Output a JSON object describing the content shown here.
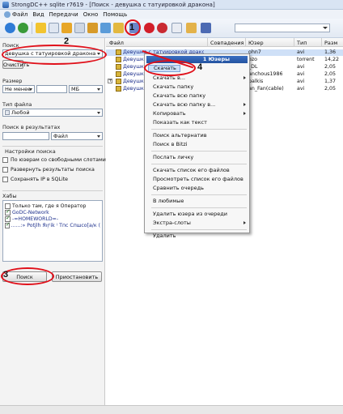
{
  "window": {
    "title": "StrongDC++ sqlite r7619 - [Поиск - девушка с татуировкой дракона]"
  },
  "menu": {
    "items": [
      "Файл",
      "Вид",
      "Передачи",
      "Окно",
      "Помощь"
    ]
  },
  "left": {
    "search_label": "Поиск",
    "search_value": "девушка с татуировкой дракона",
    "clear_button": "Очистить",
    "size_label": "Размер",
    "size_mode": "Не менее",
    "size_unit": "МБ",
    "filetype_label": "Тип файла",
    "filetype_value": "Любой",
    "inresults_label": "Поиск в результатах",
    "inresults_field": "Файл",
    "settings_label": "Настройки поиска",
    "opt1": "По юзерам со свободными слотами",
    "opt2": "Развернуть результаты поиска",
    "opt3": "Сохранять IP в SQLite",
    "hubs_label": "Хабы",
    "hubs": [
      {
        "label": "Только там, где я Оператор",
        "checked": false
      },
      {
        "label": "GoDC-Network",
        "checked": true
      },
      {
        "label": "-=HOMEWORLD=-",
        "checked": true
      },
      {
        "label": "......:» Potjlh Яıŗ⁽ik ⁾ Тпс Спшсо[а/к (",
        "checked": true
      }
    ],
    "search_button": "Поиск",
    "pause_button": "Приостановить"
  },
  "results": {
    "columns": [
      "Файл",
      "Совпадения",
      "Юзер",
      "Тип",
      "Разм"
    ],
    "rows": [
      {
        "file": "Девушка с татуировкой дракона",
        "user": "ohn7",
        "type": "avi",
        "size": "1,36"
      },
      {
        "file": "Девушк...",
        "user": "ozo",
        "type": "torrent",
        "size": "14,22"
      },
      {
        "file": "Девушк...",
        "user": "_DL",
        "type": "avi",
        "size": "2,05"
      },
      {
        "file": "Девушк...",
        "user": "anchous1986",
        "type": "avi",
        "size": "2,05"
      },
      {
        "file": "Девушк...",
        "user": "palkis",
        "type": "avi",
        "size": "1,37"
      },
      {
        "file": "Девушк...",
        "user": "an_Fan(cable)",
        "type": "avi",
        "size": "2,05"
      }
    ]
  },
  "context_menu": {
    "title": "1 Юзеры",
    "items": [
      "Скачать",
      "Скачать в...",
      "Скачать папку",
      "Скачать всю папку",
      "Скачать всю папку в...",
      "Копировать",
      "Показать как текст",
      "Поиск альтернатив",
      "Поиск в Bitzi",
      "Послать личку",
      "Скачать список его файлов",
      "Просмотреть список его файлов",
      "Сравнить очередь",
      "В любимые",
      "Удалить юзера из очереди",
      "Экстра-слоты",
      "Удалить"
    ]
  },
  "annotations": {
    "n1": "1",
    "n2": "2",
    "n3": "3",
    "n4": "4",
    "accent": "#e0101a"
  }
}
